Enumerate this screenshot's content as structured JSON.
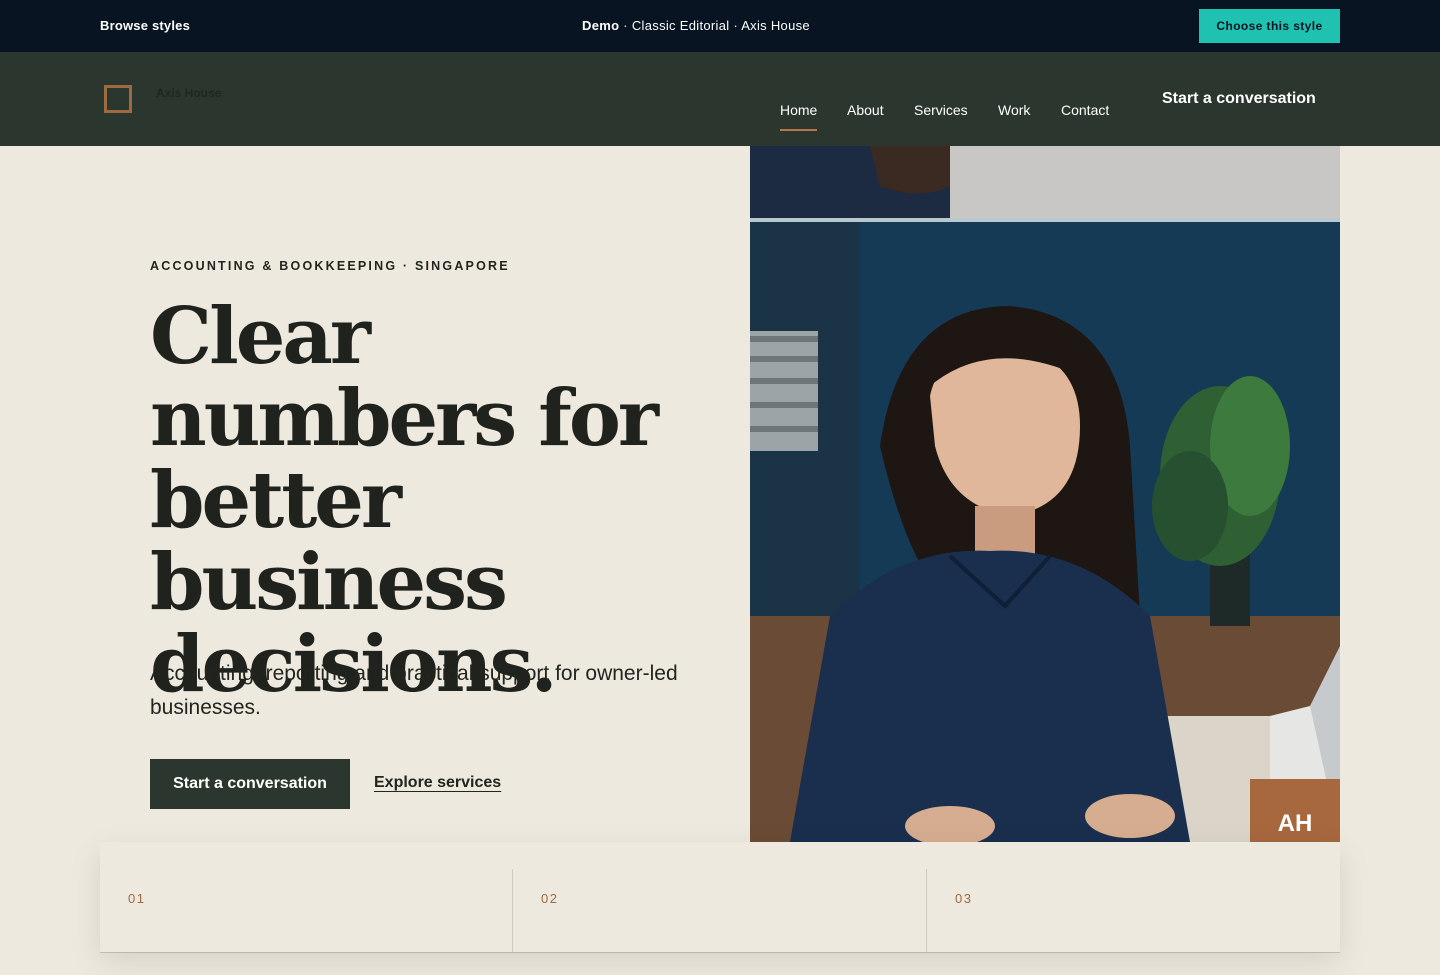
{
  "demo_bar": {
    "browse_label": "Browse styles",
    "demo_label": "Demo",
    "style_name": "Classic Editorial",
    "site_name": "Axis House",
    "separator": "·",
    "choose_label": "Choose this style"
  },
  "header": {
    "logo_text": "Axis House",
    "nav": [
      "Home",
      "About",
      "Services",
      "Work",
      "Contact"
    ],
    "active_nav": "Home",
    "cta_label": "Start a conversation"
  },
  "hero": {
    "eyebrow": "ACCOUNTING & BOOKKEEPING · SINGAPORE",
    "headline": "Clear numbers for better business decisions.",
    "lede": "Accounting, reporting and practical support for owner-led businesses.",
    "primary_cta": "Start a conversation",
    "secondary_cta": "Explore services",
    "badge": "AH"
  },
  "strip": {
    "items": [
      {
        "number": "01"
      },
      {
        "number": "02"
      },
      {
        "number": "03"
      }
    ]
  },
  "colors": {
    "demo_bar_bg": "#081422",
    "accent_teal": "#1fc2b0",
    "header_bg": "#2b362e",
    "page_bg": "#ede9de",
    "copper": "#a8683e"
  }
}
